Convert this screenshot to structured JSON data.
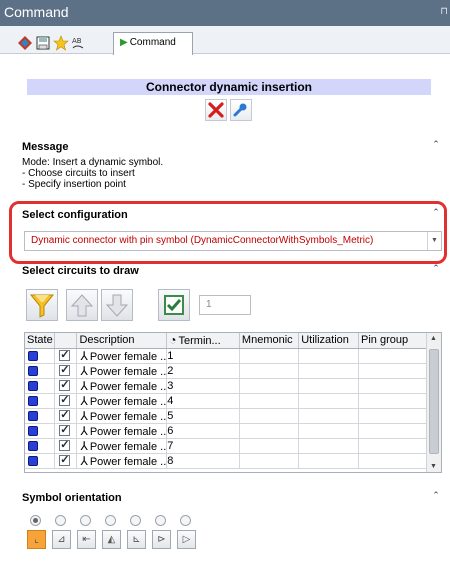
{
  "window": {
    "title": "Command"
  },
  "tabs": [
    {
      "label": "Command"
    }
  ],
  "panel": {
    "title": "Connector dynamic insertion"
  },
  "message": {
    "title": "Message",
    "lines": [
      "Mode: Insert a dynamic symbol.",
      "- Choose circuits to insert",
      "- Specify insertion point"
    ]
  },
  "configuration": {
    "title": "Select configuration",
    "selected": "Dynamic connector with pin symbol (DynamicConnectorWithSymbols_Metric)"
  },
  "circuits": {
    "title": "Select circuits to draw",
    "count": "1",
    "columns": [
      "State",
      "",
      "Description",
      "Termin...",
      "Mnemonic",
      "Utilization",
      "Pin group"
    ],
    "rows": [
      {
        "description": "Power female ..",
        "terminal": "1"
      },
      {
        "description": "Power female ..",
        "terminal": "2"
      },
      {
        "description": "Power female ..",
        "terminal": "3"
      },
      {
        "description": "Power female ..",
        "terminal": "4"
      },
      {
        "description": "Power female ..",
        "terminal": "5"
      },
      {
        "description": "Power female ..",
        "terminal": "6"
      },
      {
        "description": "Power female ..",
        "terminal": "7"
      },
      {
        "description": "Power female ..",
        "terminal": "8"
      }
    ]
  },
  "orientation": {
    "title": "Symbol orientation",
    "selected_index": 0
  },
  "colors": {
    "header_bar": "#d3d5fb",
    "title_bar": "#5d7186",
    "highlight": "#e03030",
    "combo_text": "#c00000",
    "active_orientation": "#f6a33a"
  }
}
